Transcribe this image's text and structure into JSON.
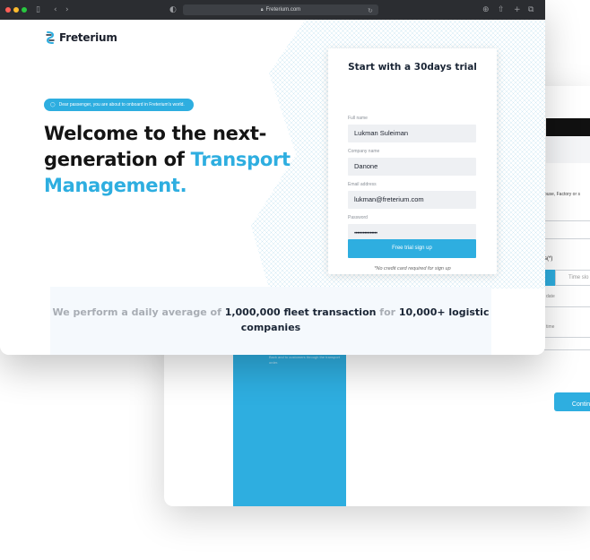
{
  "browser": {
    "url": "Freterium.com"
  },
  "page": {
    "brand": "Freterium",
    "pill_text": "Dear passenger, you are about to onboard in Freterium's world.",
    "headline": {
      "part1": "Welcome to the next-generation of ",
      "accent": "Transport Management."
    },
    "stats": {
      "muted1": "We perform a daily average of ",
      "bold1": "1,000,000 fleet transaction",
      "muted2": " for ",
      "bold2": "10,000+ logistic companies"
    }
  },
  "signup_form": {
    "title": "Start with a 30days trial",
    "fields": [
      {
        "label": "Full name",
        "value": "Lukman Suleiman"
      },
      {
        "label": "Company name",
        "value": "Danone"
      },
      {
        "label": "Email address",
        "value": "lukman@freterium.com"
      },
      {
        "label": "Password",
        "value": "••••••••••••••••"
      }
    ],
    "submit_label": "Free trial sign up",
    "note": "*No credit card required for sign up"
  },
  "back_window": {
    "hint": "ouse, Factory or s",
    "field_label": "s(*)",
    "tab_label": "Time slo",
    "date_label": "date",
    "time_label": "time",
    "continue_label": "Continu"
  },
  "colors": {
    "accent": "#2eaee0",
    "dark_text": "#1a2535"
  }
}
